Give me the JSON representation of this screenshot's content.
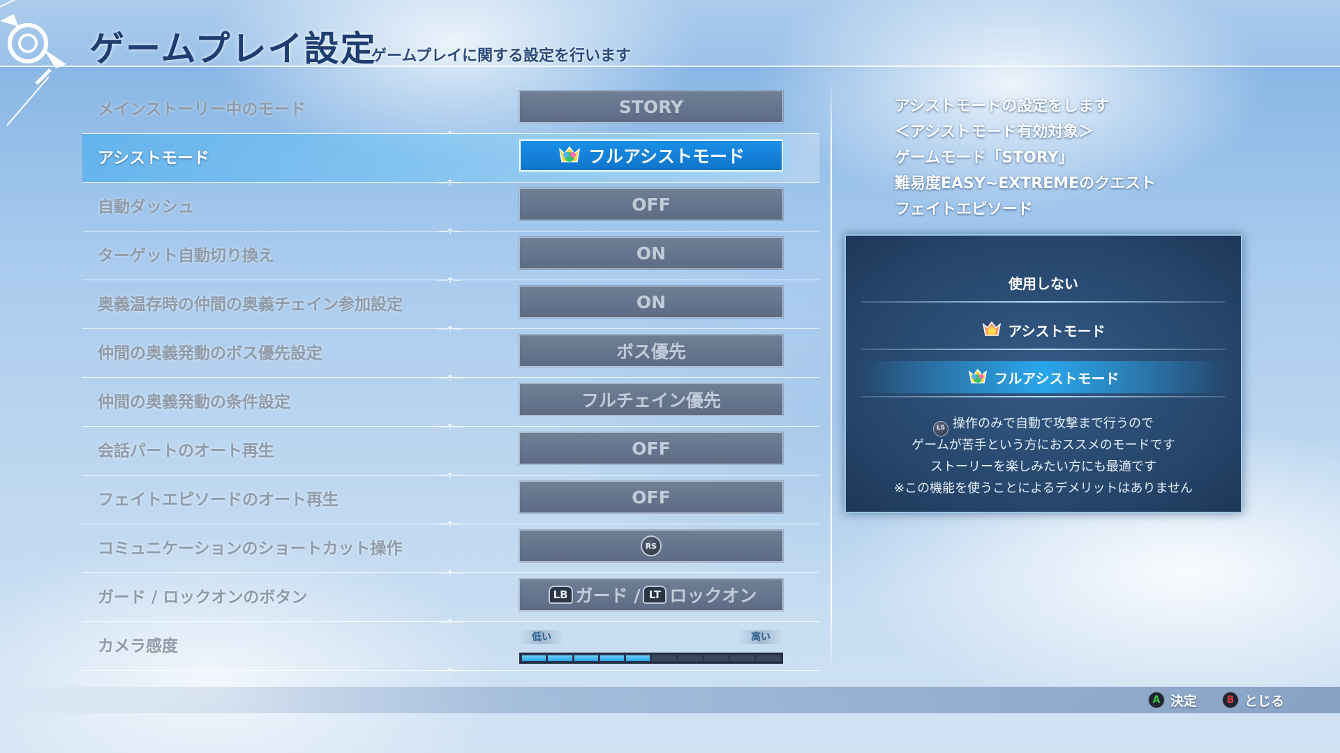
{
  "header": {
    "title": "ゲームプレイ設定",
    "subtitle": "ゲームプレイに関する設定を行います"
  },
  "settings": [
    {
      "label": "メインストーリー中のモード",
      "value": "STORY"
    },
    {
      "label": "アシストモード",
      "value": "フルアシストモード",
      "icon": "full-assist-icon",
      "selected": true
    },
    {
      "label": "自動ダッシュ",
      "value": "OFF"
    },
    {
      "label": "ターゲット自動切り換え",
      "value": "ON"
    },
    {
      "label": "奥義温存時の仲間の奥義チェイン参加設定",
      "value": "ON"
    },
    {
      "label": "仲間の奥義発動のボス優先設定",
      "value": "ボス優先"
    },
    {
      "label": "仲間の奥義発動の条件設定",
      "value": "フルチェイン優先"
    },
    {
      "label": "会話パートのオート再生",
      "value": "OFF"
    },
    {
      "label": "フェイトエピソードのオート再生",
      "value": "OFF"
    },
    {
      "label": "コミュニケーションのショートカット操作",
      "value_button": "RS"
    },
    {
      "label": "ガード / ロックオンのボタン",
      "guard_button": "LB",
      "guard_text": "ガード /",
      "lockon_button": "LT",
      "lockon_text": "ロックオン"
    },
    {
      "label": "カメラ感度",
      "slider": {
        "low_label": "低い",
        "high_label": "高い",
        "level": 5,
        "max": 10
      }
    }
  ],
  "description": [
    "アシストモードの設定をします",
    "＜アシストモード有効対象＞",
    "ゲームモード「STORY」",
    "難易度EASY~EXTREMEのクエスト",
    "フェイトエピソード"
  ],
  "panel": {
    "options": [
      {
        "label": "使用しない"
      },
      {
        "label": "アシストモード",
        "icon": "assist-icon"
      },
      {
        "label": "フルアシストモード",
        "icon": "full-assist-icon",
        "selected": true
      }
    ],
    "ls_button": "LS",
    "desc_first": "操作のみで自動で攻撃まで行うので",
    "desc_lines": [
      "ゲームが苦手という方におススメのモードです",
      "ストーリーを楽しみたい方にも最適です",
      "※この機能を使うことによるデメリットはありません"
    ]
  },
  "footer": {
    "confirm_button": "A",
    "confirm_label": "決定",
    "close_button": "B",
    "close_label": "とじる"
  },
  "colors": {
    "accent": "#1a8fe6",
    "title": "#1e3d70",
    "inactive_text": "#8f9ba8"
  }
}
